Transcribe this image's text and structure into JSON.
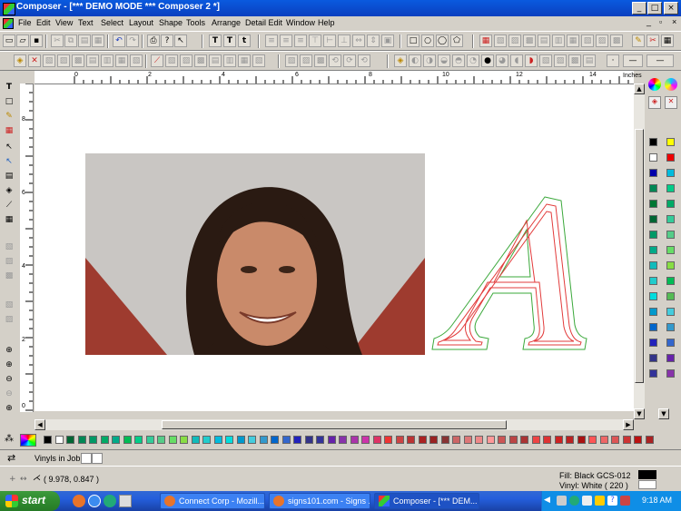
{
  "window": {
    "title": "Composer - [*** DEMO MODE *** Composer 2 *]",
    "controls": {
      "minimize": "_",
      "maximize": "□",
      "close": "×"
    }
  },
  "menu": [
    "File",
    "Edit",
    "View",
    "Text",
    "Select",
    "Layout",
    "Shape",
    "Tools",
    "Arrange",
    "Detail Edit",
    "Window",
    "Help"
  ],
  "ruler": {
    "units": "Inches",
    "h_labels": [
      "0",
      "2",
      "4",
      "6",
      "8",
      "10",
      "12",
      "14"
    ],
    "v_labels": [
      "8",
      "6",
      "4",
      "2",
      "0"
    ]
  },
  "canvas": {
    "letter": "A",
    "photo_description_colors": {
      "bg": "#c9c6c3",
      "red": "#9e3b2f",
      "hair": "#2a1a12",
      "skin": "#c98a6a"
    }
  },
  "colors": {
    "outline_red": "#e23b3b",
    "outline_green": "#3aa83a",
    "title_blue": "#0a4fd0"
  },
  "vinyls": {
    "label": "Vinyls in Job:"
  },
  "status": {
    "coords": "( 9.978, 0.847 )",
    "fill": "Fill: Black GCS-012",
    "vinyl": "Vinyl: White ( 220 )"
  },
  "taskbar": {
    "start": "start",
    "tasks": [
      "Connect Corp - Mozill...",
      "signs101.com - Signs ...",
      "Composer - [*** DEM..."
    ],
    "clock": "9:18 AM"
  },
  "icons": {
    "toolbar_text": [
      "T",
      "T",
      "t"
    ]
  }
}
